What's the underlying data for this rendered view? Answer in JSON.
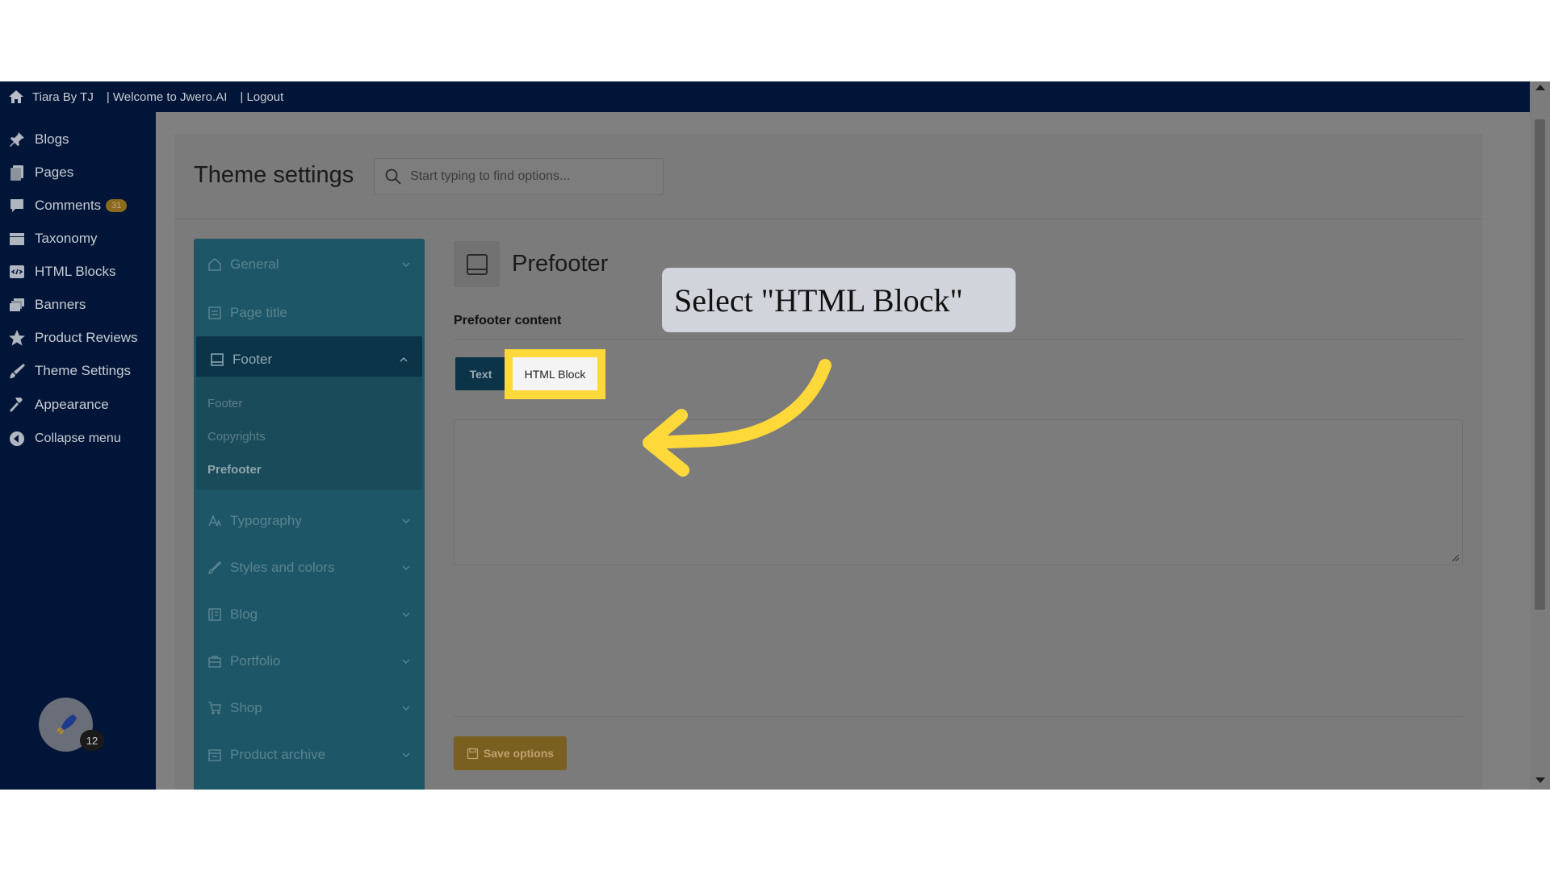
{
  "adminbar": {
    "site_name": "Tiara By TJ",
    "welcome": "| Welcome to Jwero.AI",
    "logout": "| Logout"
  },
  "adminmenu": {
    "items": [
      {
        "label": "Blogs",
        "icon": "pin-icon"
      },
      {
        "label": "Pages",
        "icon": "pages-icon"
      },
      {
        "label": "Comments",
        "icon": "comment-icon",
        "badge": "31"
      },
      {
        "label": "Taxonomy",
        "icon": "taxonomy-icon"
      },
      {
        "label": "HTML Blocks",
        "icon": "html-block-icon"
      },
      {
        "label": "Banners",
        "icon": "banners-icon"
      },
      {
        "label": "Product Reviews",
        "icon": "star-icon"
      },
      {
        "label": "Theme Settings",
        "icon": "brush-icon"
      },
      {
        "label": "Appearance",
        "icon": "hammer-icon"
      },
      {
        "label": "Collapse menu",
        "icon": "collapse-icon"
      }
    ],
    "rocket_count": "12"
  },
  "header": {
    "title": "Theme settings",
    "search_placeholder": "Start typing to find options..."
  },
  "settings_nav": {
    "items": [
      {
        "label": "General",
        "icon": "home-icon"
      },
      {
        "label": "Page title",
        "icon": "page-title-icon"
      },
      {
        "label": "Footer",
        "icon": "footer-icon",
        "expanded": true
      },
      {
        "label": "Typography",
        "icon": "typography-icon"
      },
      {
        "label": "Styles and colors",
        "icon": "brush-icon"
      },
      {
        "label": "Blog",
        "icon": "blog-icon"
      },
      {
        "label": "Portfolio",
        "icon": "portfolio-icon"
      },
      {
        "label": "Shop",
        "icon": "cart-icon"
      },
      {
        "label": "Product archive",
        "icon": "archive-icon"
      }
    ],
    "footer_sub": [
      "Footer",
      "Copyrights",
      "Prefooter"
    ],
    "current_sub": "Prefooter"
  },
  "section": {
    "title": "Prefooter",
    "field_label": "Prefooter content",
    "toggle": {
      "text": "Text",
      "html_block": "HTML Block",
      "selected": "Text"
    },
    "textarea_value": "",
    "save_label": "Save options"
  },
  "callout": {
    "text": "Select \"HTML Block\""
  },
  "colors": {
    "admin_bg": "#011538",
    "nav_bg": "#1d5666",
    "highlight": "#ffd83a",
    "save_btn": "#7a6020"
  }
}
